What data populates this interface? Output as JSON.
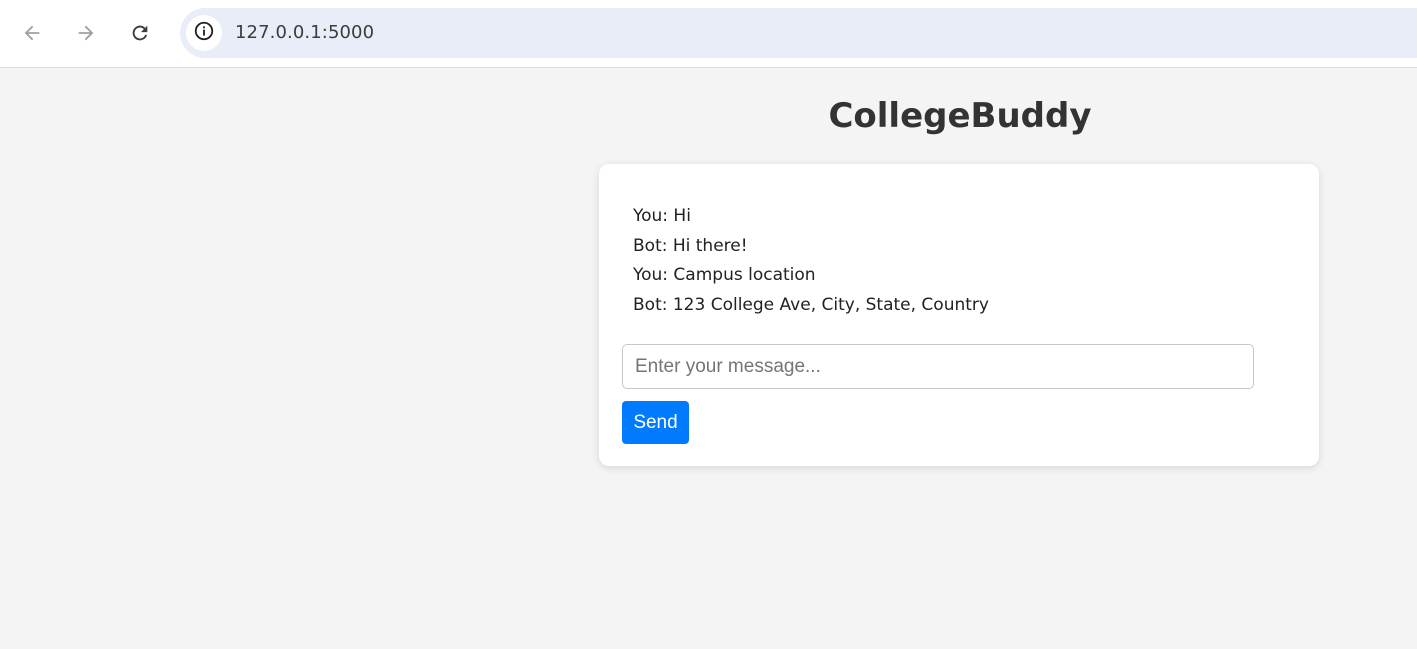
{
  "browser": {
    "back_icon": "arrow-left-icon",
    "forward_icon": "arrow-right-icon",
    "reload_icon": "reload-icon",
    "site_info_icon": "info-icon",
    "url": "127.0.0.1:5000"
  },
  "app": {
    "title": "CollegeBuddy"
  },
  "chat": {
    "messages": [
      {
        "text": "You: Hi"
      },
      {
        "text": "Bot: Hi there!"
      },
      {
        "text": "You: Campus location"
      },
      {
        "text": "Bot: 123 College Ave, City, State, Country"
      }
    ],
    "input": {
      "value": "",
      "placeholder": "Enter your message..."
    },
    "send_label": "Send"
  },
  "colors": {
    "page_background": "#f4f4f4",
    "card_background": "#ffffff",
    "send_button": "#007bff",
    "omnibox": "#e9edf7"
  }
}
